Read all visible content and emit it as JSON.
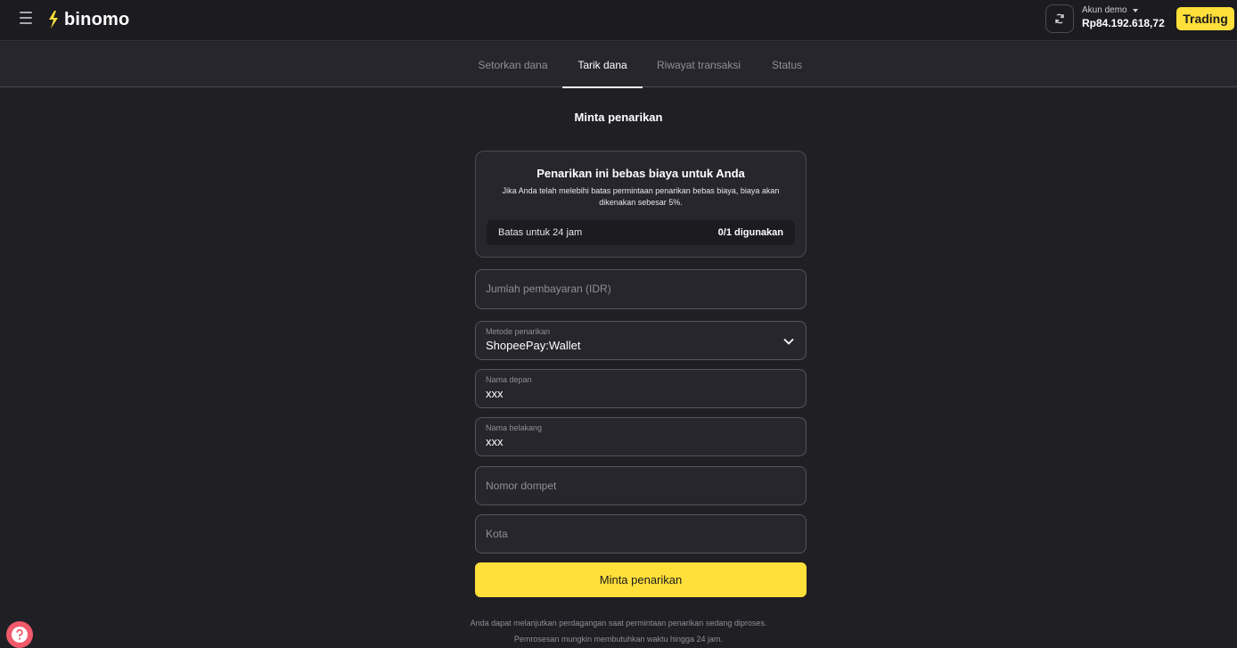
{
  "header": {
    "logo_text": "binomo",
    "account_label": "Akun demo",
    "balance": "Rp84.192.618,72",
    "trading_label": "Trading"
  },
  "tabs": [
    {
      "label": "Setorkan dana",
      "active": false
    },
    {
      "label": "Tarik dana",
      "active": true
    },
    {
      "label": "Riwayat transaksi",
      "active": false
    },
    {
      "label": "Status",
      "active": false
    }
  ],
  "page_title": "Minta penarikan",
  "info": {
    "title": "Penarikan ini bebas biaya untuk Anda",
    "description": "Jika Anda telah melebihi batas permintaan penarikan bebas biaya, biaya akan dikenakan sebesar 5%.",
    "limit_label": "Batas untuk 24 jam",
    "limit_value": "0/1 digunakan"
  },
  "form": {
    "amount_placeholder": "Jumlah pembayaran (IDR)",
    "method_label": "Metode penarikan",
    "method_value": "ShopeePay:Wallet",
    "first_name_label": "Nama depan",
    "first_name_value": "xxx",
    "last_name_label": "Nama belakang",
    "last_name_value": "xxx",
    "wallet_placeholder": "Nomor dompet",
    "city_placeholder": "Kota",
    "submit_label": "Minta penarikan"
  },
  "notes": {
    "line1": "Anda dapat melanjutkan perdagangan saat permintaan penarikan sedang diproses.",
    "line2": "Pemrosesan mungkin membutuhkan waktu hingga 24 jam."
  },
  "colors": {
    "accent": "#ffdf3a",
    "background": "#1f1f24",
    "help": "#f05a6a"
  }
}
